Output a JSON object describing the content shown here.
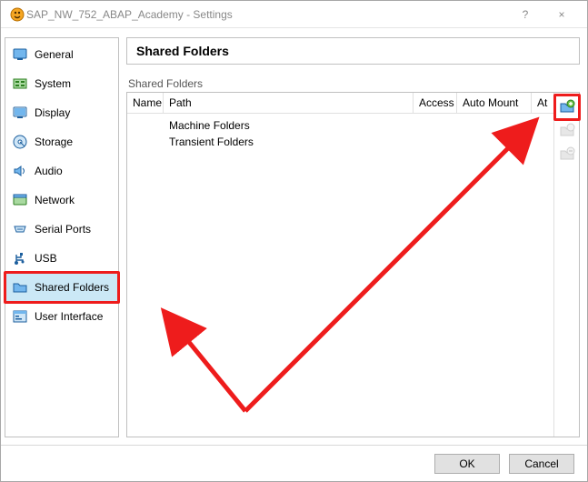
{
  "window": {
    "title": "SAP_NW_752_ABAP_Academy - Settings",
    "help": "?",
    "close": "×"
  },
  "sidebar": {
    "items": [
      {
        "label": "General",
        "icon": "general-icon"
      },
      {
        "label": "System",
        "icon": "system-icon"
      },
      {
        "label": "Display",
        "icon": "display-icon"
      },
      {
        "label": "Storage",
        "icon": "storage-icon"
      },
      {
        "label": "Audio",
        "icon": "audio-icon"
      },
      {
        "label": "Network",
        "icon": "network-icon"
      },
      {
        "label": "Serial Ports",
        "icon": "serial-ports-icon"
      },
      {
        "label": "USB",
        "icon": "usb-icon"
      },
      {
        "label": "Shared Folders",
        "icon": "shared-folders-icon"
      },
      {
        "label": "User Interface",
        "icon": "user-interface-icon"
      }
    ],
    "selected_index": 8
  },
  "main": {
    "section_title": "Shared Folders",
    "group_label": "Shared Folders",
    "columns": {
      "name": "Name",
      "path": "Path",
      "access": "Access",
      "auto_mount": "Auto Mount",
      "at": "At"
    },
    "tree": [
      {
        "label": "Machine Folders"
      },
      {
        "label": "Transient Folders"
      }
    ]
  },
  "footer": {
    "ok": "OK",
    "cancel": "Cancel"
  },
  "colors": {
    "highlight": "#ee1c1c",
    "vb_blue": "#2f8ad8",
    "vb_orange": "#ef8b1a",
    "sel_bg": "#cbe8f6"
  }
}
